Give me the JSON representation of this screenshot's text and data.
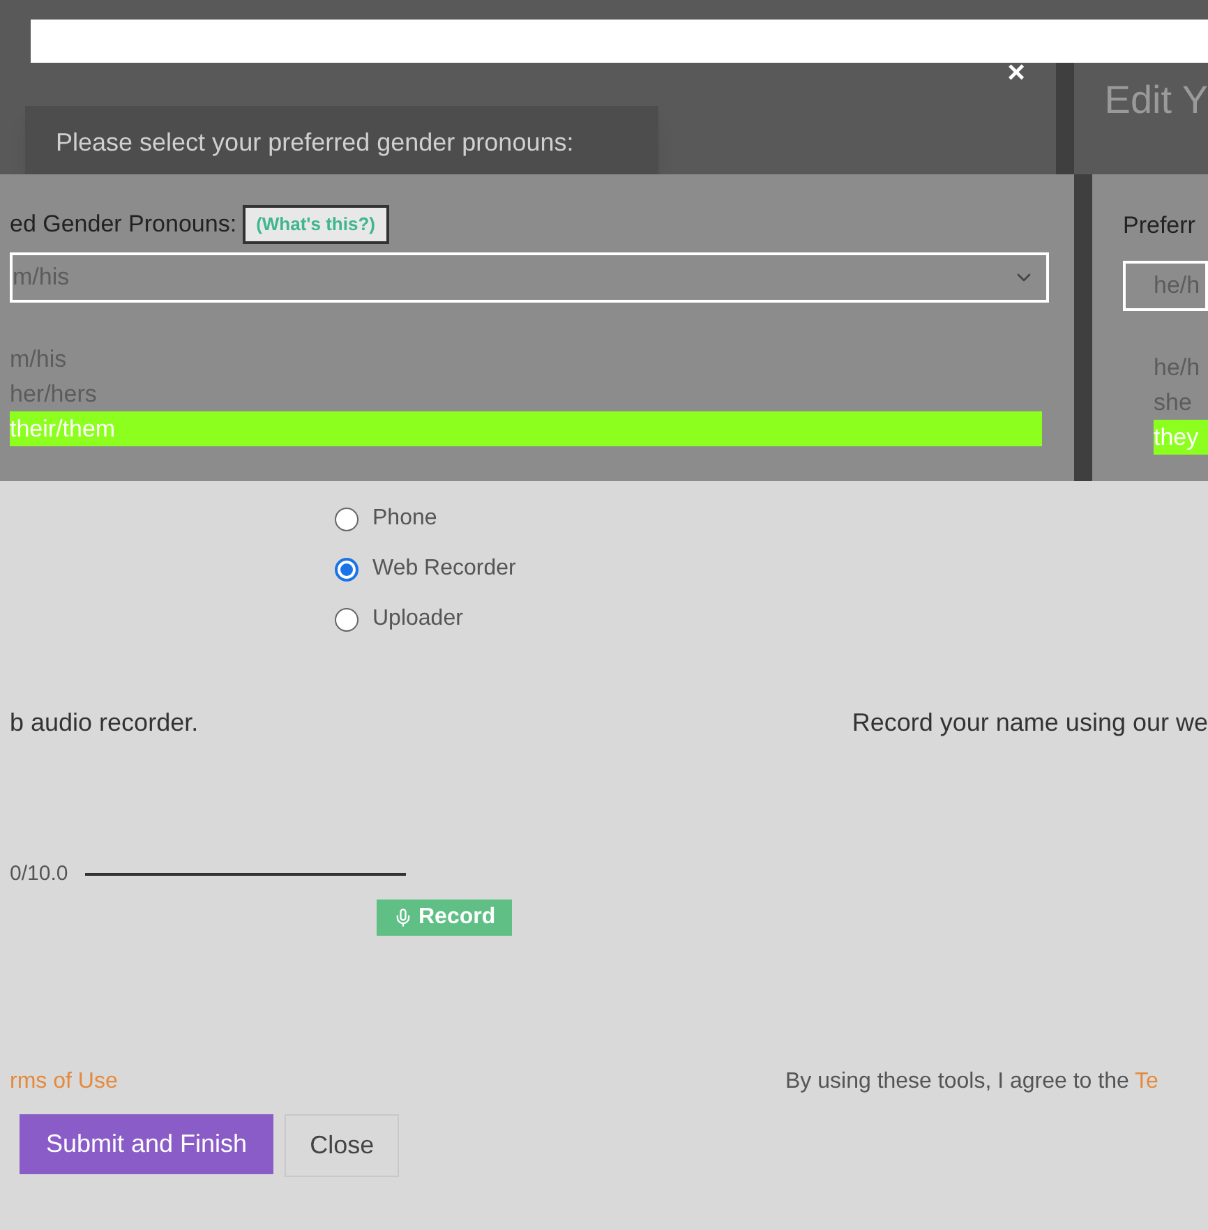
{
  "tooltip": {
    "text": "Please select your preferred gender pronouns:"
  },
  "close": "×",
  "left_panel": {
    "label": "ed Gender Pronouns:",
    "help_button": "(What's this?)",
    "select_value": "m/his",
    "options": [
      {
        "label": "m/his",
        "selected": false
      },
      {
        "label": "her/hers",
        "selected": false
      },
      {
        "label": "their/them",
        "selected": true
      }
    ]
  },
  "right_panel": {
    "title": "Edit Y",
    "label": "Preferr",
    "select_value": "he/h",
    "options": [
      {
        "label": "he/h",
        "selected": false
      },
      {
        "label": "she",
        "selected": false
      },
      {
        "label": "they",
        "selected": true
      }
    ]
  },
  "methods": [
    {
      "label": "Phone",
      "selected": false
    },
    {
      "label": "Web Recorder",
      "selected": true
    },
    {
      "label": "Uploader",
      "selected": false
    }
  ],
  "recorder": {
    "left_heading": "b audio recorder.",
    "right_heading": "Record your name using our we",
    "timer": "0/10.0",
    "record_button": "Record"
  },
  "terms": {
    "left_link": "rms of Use",
    "right_text": "By using these tools, I agree to the ",
    "right_link": "Te"
  },
  "buttons": {
    "submit": "Submit and Finish",
    "close": "Close"
  }
}
